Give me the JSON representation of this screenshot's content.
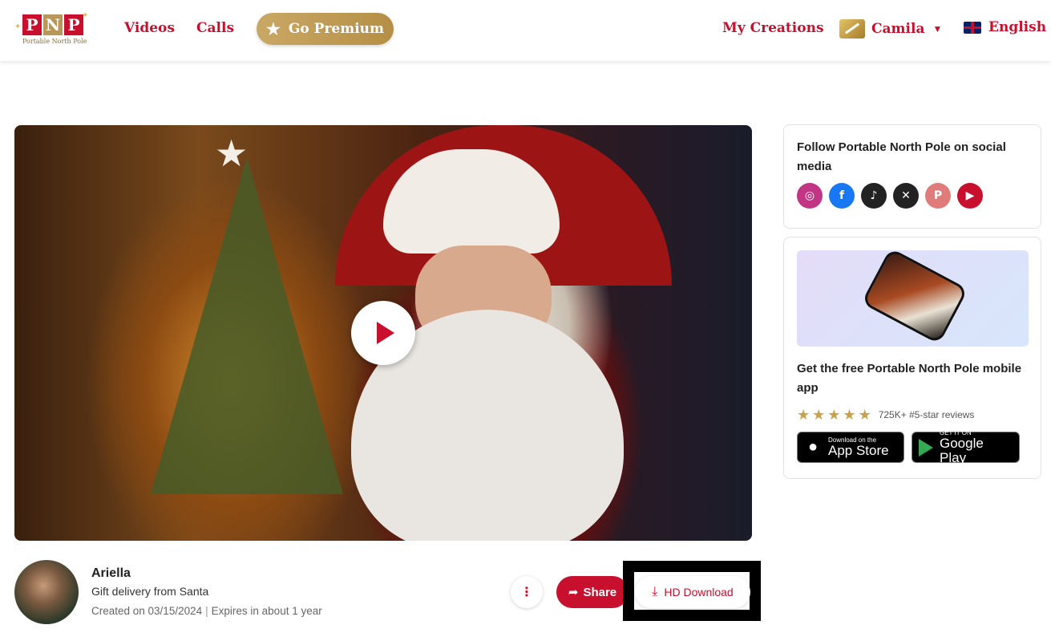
{
  "header": {
    "logo_letters": [
      "P",
      "N",
      "P"
    ],
    "logo_subtitle": "Portable North Pole",
    "nav": {
      "videos": "Videos",
      "calls": "Calls"
    },
    "premium_label": "Go Premium",
    "my_creations": "My Creations",
    "user_name": "Camila",
    "language": "English"
  },
  "video": {
    "thumbnail_subject": "Santa Claus by Christmas tree"
  },
  "social_card": {
    "title": "Follow Portable North Pole on social media",
    "icons": [
      "instagram-icon",
      "facebook-icon",
      "tiktok-icon",
      "x-icon",
      "pinterest-icon",
      "youtube-icon"
    ]
  },
  "app_card": {
    "title": "Get the free Portable North Pole mobile app",
    "rating_text": "725K+ #5-star reviews",
    "stars": 5,
    "app_store_small": "Download on the",
    "app_store_big": "App Store",
    "google_small": "GET IT ON",
    "google_big": "Google Play"
  },
  "creation": {
    "name": "Ariella",
    "subtitle": "Gift delivery from Santa",
    "created": "Created on 03/15/2024",
    "expires": "Expires in about 1 year",
    "share_label": "Share",
    "hd_download_label": "HD Download"
  },
  "colors": {
    "brand_red": "#c8102e",
    "gold": "#c9a865"
  }
}
